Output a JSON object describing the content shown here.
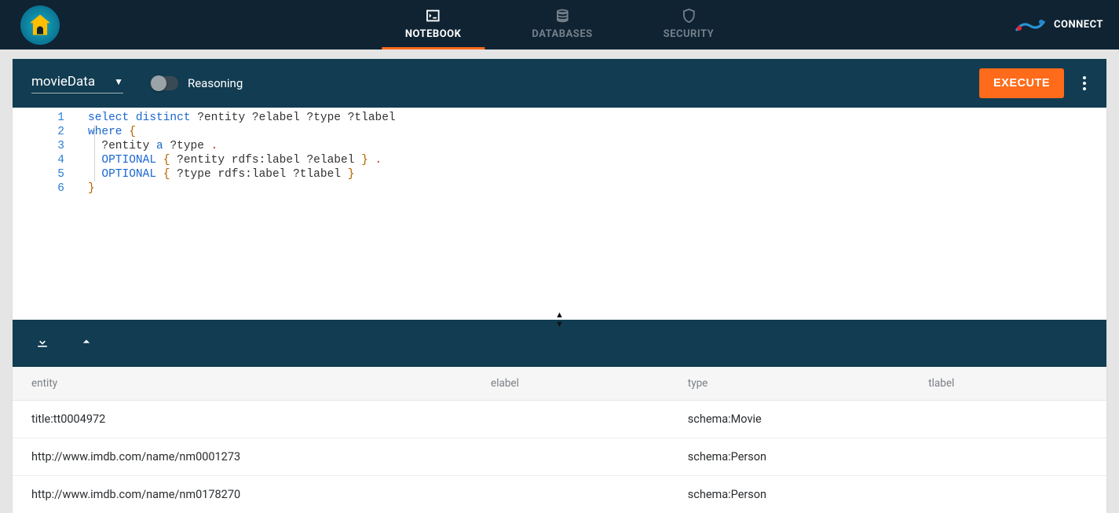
{
  "nav": {
    "tabs": [
      {
        "id": "notebook",
        "label": "NOTEBOOK",
        "active": true
      },
      {
        "id": "databases",
        "label": "DATABASES",
        "active": false
      },
      {
        "id": "security",
        "label": "SECURITY",
        "active": false
      }
    ],
    "connect_label": "CONNECT"
  },
  "cell": {
    "database": "movieData",
    "reasoning_label": "Reasoning",
    "reasoning_enabled": false,
    "execute_label": "EXECUTE"
  },
  "code_lines": [
    "select distinct ?entity ?elabel ?type ?tlabel",
    "where {",
    "  ?entity a ?type .",
    "  OPTIONAL { ?entity rdfs:label ?elabel } .",
    "  OPTIONAL { ?type rdfs:label ?tlabel }",
    "}"
  ],
  "results": {
    "columns": [
      "entity",
      "elabel",
      "type",
      "tlabel"
    ],
    "rows": [
      {
        "entity": "title:tt0004972",
        "elabel": "",
        "type": "schema:Movie",
        "tlabel": ""
      },
      {
        "entity": "http://www.imdb.com/name/nm0001273",
        "elabel": "",
        "type": "schema:Person",
        "tlabel": ""
      },
      {
        "entity": "http://www.imdb.com/name/nm0178270",
        "elabel": "",
        "type": "schema:Person",
        "tlabel": ""
      }
    ]
  },
  "colors": {
    "topnav_bg": "#0f2333",
    "panel_bg": "#113c51",
    "accent": "#ff6b1a",
    "page_bg": "#e5e5e5"
  }
}
